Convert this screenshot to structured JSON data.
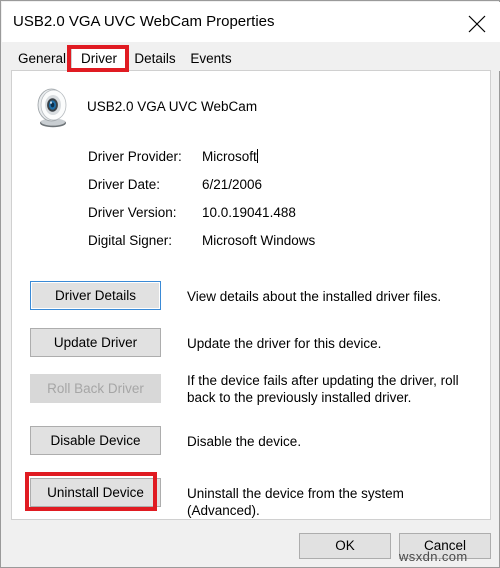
{
  "window": {
    "title": "USB2.0 VGA UVC WebCam Properties",
    "close_label": "close-icon"
  },
  "tabs": [
    {
      "label": "General",
      "active": false
    },
    {
      "label": "Driver",
      "active": true
    },
    {
      "label": "Details",
      "active": false
    },
    {
      "label": "Events",
      "active": false
    }
  ],
  "device": {
    "name": "USB2.0 VGA UVC WebCam",
    "icon": "webcam-icon"
  },
  "properties": [
    {
      "label": "Driver Provider:",
      "value": "Microsoft"
    },
    {
      "label": "Driver Date:",
      "value": "6/21/2006"
    },
    {
      "label": "Driver Version:",
      "value": "10.0.19041.488"
    },
    {
      "label": "Digital Signer:",
      "value": "Microsoft Windows"
    }
  ],
  "actions": [
    {
      "button": "Driver Details",
      "description": "View details about the installed driver files.",
      "state": "focused"
    },
    {
      "button": "Update Driver",
      "description": "Update the driver for this device.",
      "state": "enabled"
    },
    {
      "button": "Roll Back Driver",
      "description": "If the device fails after updating the driver, roll back to the previously installed driver.",
      "state": "disabled"
    },
    {
      "button": "Disable Device",
      "description": "Disable the device.",
      "state": "enabled"
    },
    {
      "button": "Uninstall Device",
      "description": "Uninstall the device from the system (Advanced).",
      "state": "enabled"
    }
  ],
  "footer": {
    "ok_label": "OK",
    "cancel_label": "Cancel"
  },
  "annotations": {
    "color": "#e01b22",
    "targets": [
      "Driver",
      "Uninstall Device"
    ]
  },
  "watermark": "wsxdn.com"
}
